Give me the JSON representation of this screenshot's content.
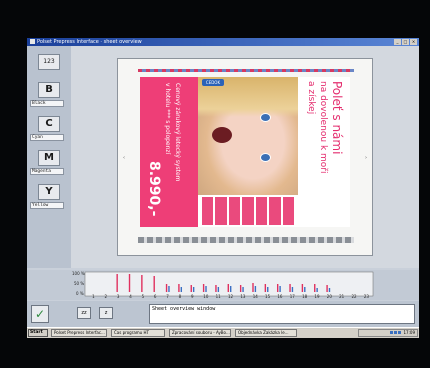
{
  "window": {
    "title": "Polset Prepress Interface · sheet overview",
    "controls": [
      "_",
      "□",
      "×"
    ]
  },
  "left_panel": {
    "page_button": "123",
    "channels": [
      {
        "button": "B",
        "label": "Black"
      },
      {
        "button": "C",
        "label": "Cyan"
      },
      {
        "button": "M",
        "label": "Magenta"
      },
      {
        "button": "Y",
        "label": "Yellow"
      }
    ]
  },
  "sheet": {
    "headline_line1": "Poleť s námi",
    "headline_line2": "na dovolenou k moři",
    "headline_line3": "a získej",
    "left_text_1": "Cenový zárukový letecký system",
    "left_text_2": "v hotelu *** s polopenzí",
    "price": "8.990,-",
    "logo": "CEDOK"
  },
  "ink_profile": {
    "y_labels": [
      "100 %",
      "50 %",
      "0 %"
    ],
    "zone_count": 23,
    "zone_labels": [
      "1",
      "2",
      "3",
      "4",
      "5",
      "6",
      "7",
      "8",
      "9",
      "10",
      "11",
      "12",
      "13",
      "14",
      "15",
      "16",
      "17",
      "18",
      "19",
      "20",
      "21",
      "22",
      "23"
    ]
  },
  "chart_data": {
    "type": "bar",
    "categories": [
      "1",
      "2",
      "3",
      "4",
      "5",
      "6",
      "7",
      "8",
      "9",
      "10",
      "11",
      "12",
      "13",
      "14",
      "15",
      "16",
      "17",
      "18",
      "19",
      "20",
      "21",
      "22",
      "23"
    ],
    "series": [
      {
        "values": [
          0,
          0,
          90,
          90,
          85,
          80,
          40,
          40,
          35,
          40,
          35,
          40,
          35,
          45,
          40,
          40,
          40,
          40,
          40,
          35,
          0,
          0,
          0
        ],
        "color": "#e0315f"
      },
      {
        "values": [
          0,
          0,
          0,
          0,
          0,
          0,
          30,
          25,
          25,
          30,
          25,
          30,
          25,
          30,
          25,
          30,
          25,
          25,
          20,
          20,
          0,
          0,
          0
        ],
        "color": "#3b6fc4"
      }
    ],
    "ylim": [
      0,
      100
    ]
  },
  "controls": {
    "ok": "✓",
    "zoom_out": "zz",
    "zoom_in": "z",
    "message": "Sheet overview window"
  },
  "taskbar": {
    "start": "Start",
    "tasks": [
      "Polset Prepress Interfac...",
      "Čas programu HT",
      "Zpracování souboru - AyBo...",
      "Objednávka Zakázka le..."
    ],
    "clock": "17:09"
  }
}
